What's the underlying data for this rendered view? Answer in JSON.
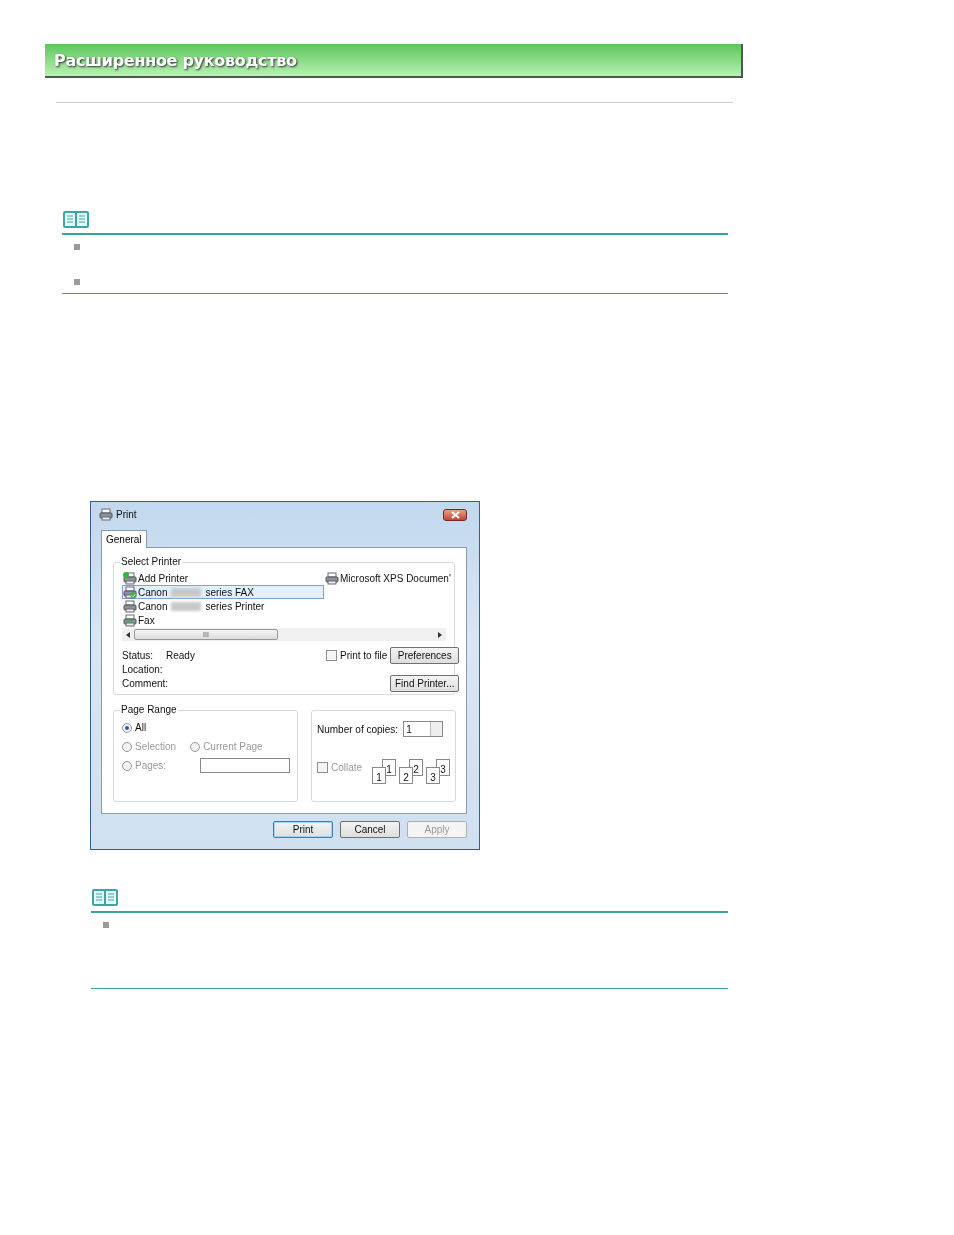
{
  "header": {
    "title": "Расширенное руководство"
  },
  "notes": [
    {
      "items": [
        {
          "kind": "bullet"
        },
        {
          "kind": "bullet"
        }
      ]
    },
    {
      "items": [
        {
          "kind": "bullet"
        }
      ]
    }
  ],
  "dialog": {
    "title": "Print",
    "tabs": [
      {
        "label": "General",
        "selected": true
      }
    ],
    "select_printer": {
      "label": "Select Printer",
      "columns": [
        [
          {
            "kind": "add",
            "name": "Add Printer",
            "selected": false
          },
          {
            "kind": "fax",
            "name": "Canon",
            "suffix": "series FAX",
            "selected": true
          },
          {
            "kind": "printer",
            "name": "Canon",
            "suffix": "series Printer",
            "selected": false
          },
          {
            "kind": "plainfax",
            "name": "Fax",
            "selected": false
          }
        ],
        [
          {
            "kind": "printer",
            "name": "Microsoft XPS Documen'",
            "selected": false
          }
        ]
      ],
      "scroll_grip": "III",
      "status_label": "Status:",
      "status": "Ready",
      "location_label": "Location:",
      "comment_label": "Comment:",
      "print_to_file": {
        "label": "Print to file",
        "checked": false
      },
      "preferences": "Preferences",
      "find_printer": "Find Printer..."
    },
    "page_range": {
      "label": "Page Range",
      "options": [
        {
          "label": "All",
          "selected": true,
          "disabled": false
        },
        {
          "label": "Selection",
          "selected": false,
          "disabled": true
        },
        {
          "label": "Current Page",
          "selected": false,
          "disabled": true
        },
        {
          "label": "Pages:",
          "selected": false,
          "disabled": true
        }
      ]
    },
    "copies": {
      "label": "Number of copies:",
      "value": "1",
      "collate": {
        "label": "Collate",
        "checked": false,
        "disabled": true
      },
      "collate_pages": [
        {
          "back": "1",
          "front": "1"
        },
        {
          "back": "2",
          "front": "2"
        },
        {
          "back": "3",
          "front": "3"
        }
      ]
    },
    "buttons": [
      {
        "label": "Print",
        "kind": "default",
        "disabled": false
      },
      {
        "label": "Cancel",
        "kind": "normal",
        "disabled": false
      },
      {
        "label": "Apply",
        "kind": "normal",
        "disabled": true
      }
    ]
  }
}
